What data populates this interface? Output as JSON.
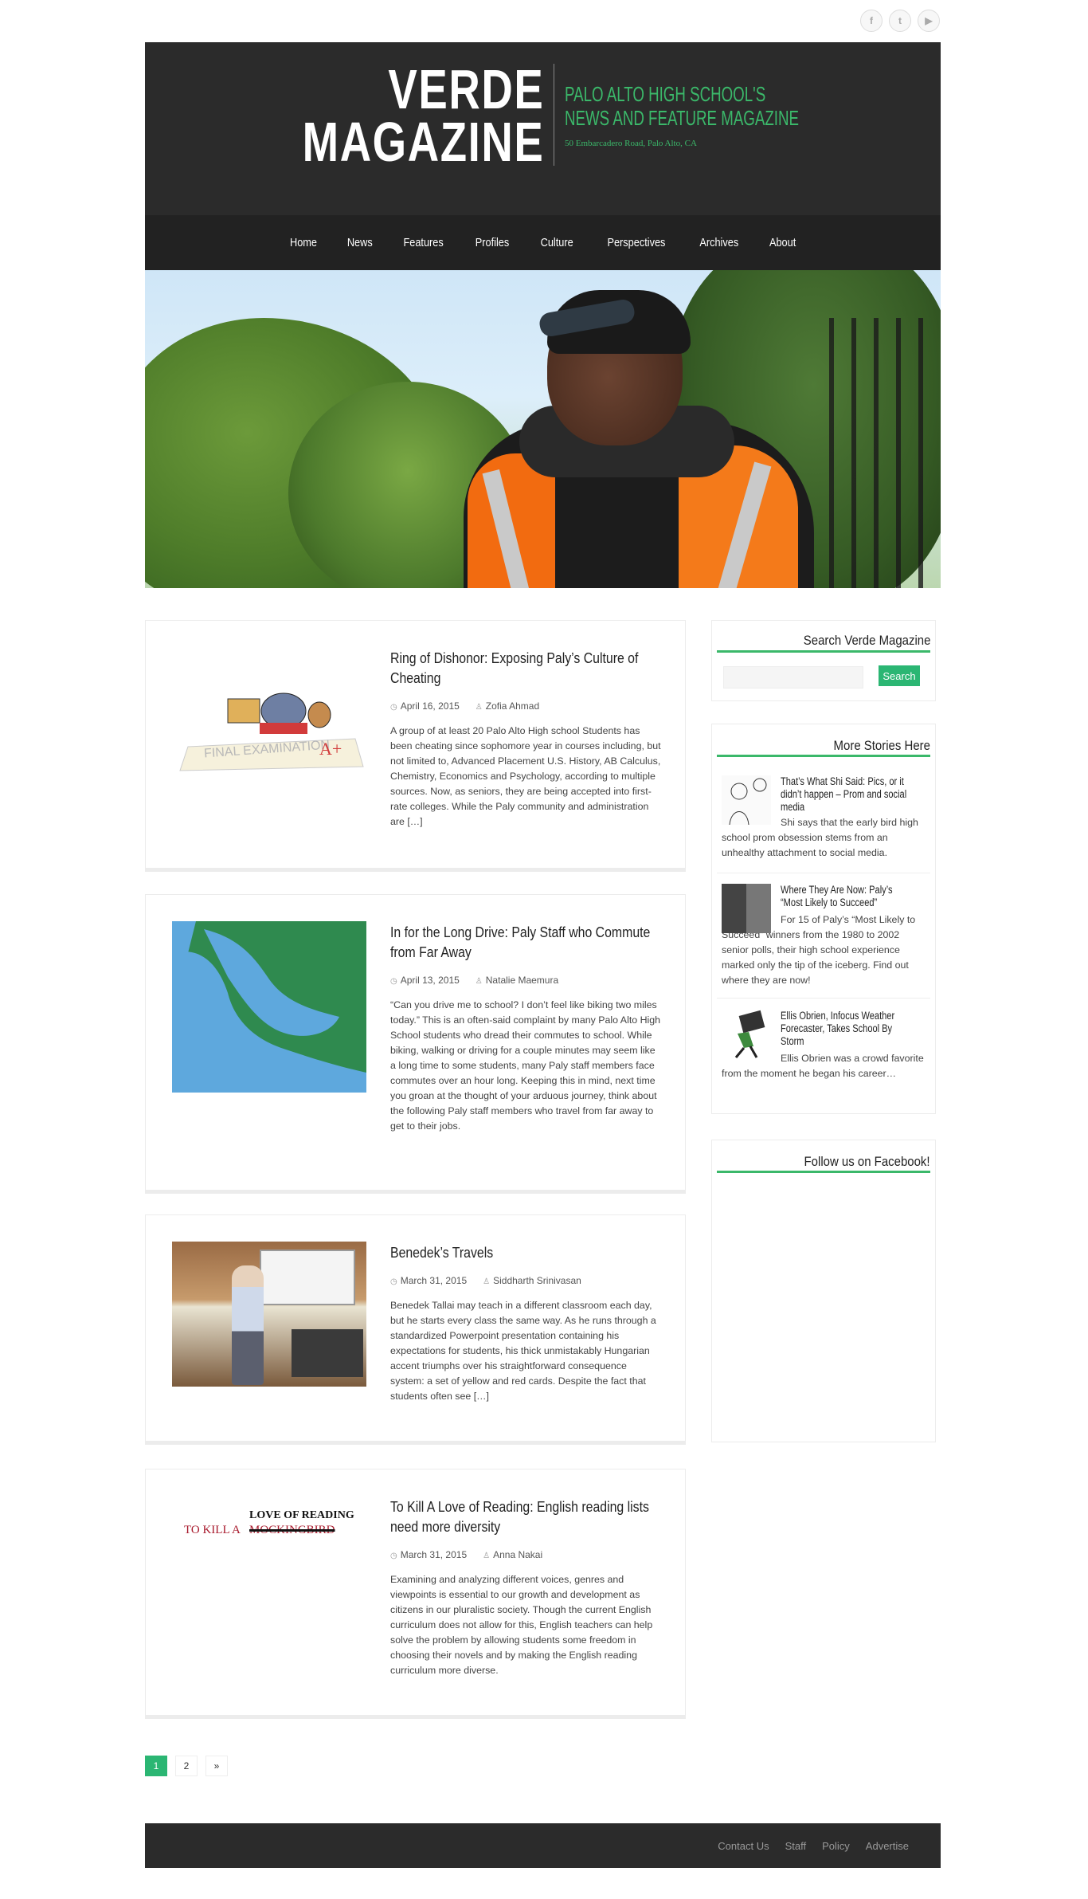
{
  "social": {
    "facebook": "f",
    "twitter": "t",
    "youtube": "▶"
  },
  "header": {
    "title_line1": "VERDE",
    "title_line2": "MAGAZINE",
    "tagline_line1": "PALO ALTO HIGH SCHOOL'S",
    "tagline_line2": "NEWS AND FEATURE MAGAZINE",
    "address": "50 Embarcadero Road, Palo Alto, CA"
  },
  "nav": [
    "Home",
    "News",
    "Features",
    "Profiles",
    "Culture",
    "Perspectives",
    "Archives",
    "About"
  ],
  "posts": [
    {
      "title": "Ring of Dishonor: Exposing Paly’s Culture of Cheating",
      "date": "April 16, 2015",
      "author": "Zofia Ahmad",
      "excerpt": "A group of at least 20 Palo Alto High school Students has been cheating since sophomore year in courses including, but not limited to, Advanced Placement U.S. History, AB Calculus, Chemistry, Economics and Psychology, according to multiple sources. Now, as seniors, they are being accepted into first-rate colleges. While the Paly community and administration are […]",
      "thumb_text": "FINAL EXAMINATION",
      "thumb_grade": "A+"
    },
    {
      "title": "In for the Long Drive: Paly Staff who Commute from Far Away",
      "date": "April 13, 2015",
      "author": "Natalie Maemura",
      "excerpt": "“Can you drive me to school? I don’t feel like biking two miles today.” This is an often-said complaint by many Palo Alto High School students who dread their commutes to school. While biking, walking or driving for a couple minutes may seem like a long time to some students, many Paly staff members face commutes over an hour long. Keeping this in mind, next time you groan at the thought of your arduous journey, think about the following Paly staff members who travel from far away to get to their jobs."
    },
    {
      "title": "Benedek’s Travels",
      "date": "March 31, 2015",
      "author": "Siddharth Srinivasan",
      "excerpt": "Benedek Tallai may teach in a different classroom each day, but he starts every class the same way. As he runs through a standardized Powerpoint presentation containing his expectations for students, his thick unmistakably Hungarian accent triumphs over his straightforward consequence system: a set of yellow and red cards. Despite the fact that students often see […]"
    },
    {
      "title": "To Kill A Love of Reading: English reading lists need more diversity",
      "date": "March 31, 2015",
      "author": "Anna Nakai",
      "excerpt": "Examining and analyzing different voices, genres and viewpoints is essential to our growth and development as citizens in our pluralistic society. Though the current English curriculum does not allow for this, English teachers can help solve the problem by allowing students some freedom in choosing their novels and by making the English reading curriculum more diverse.",
      "thumb_left": "TO KILL A",
      "thumb_struck": "MOCKINGBIRD",
      "thumb_top": "LOVE OF READING"
    }
  ],
  "sidebar": {
    "search_title": "Search Verde Magazine",
    "search_button": "Search",
    "search_placeholder": "",
    "more_title": "More Stories Here",
    "stories": [
      {
        "title": "That’s What Shi Said: Pics, or it didn’t happen – Prom and social media",
        "excerpt": "Shi says that the early bird high school prom obsession stems from an unhealthy attachment to social media."
      },
      {
        "title": "Where They Are Now: Paly’s “Most Likely to Succeed”",
        "excerpt": "For 15 of Paly’s “Most Likely to Succeed” winners from the 1980 to 2002 senior polls, their high school experience marked only the tip of the iceberg. Find out where they are now!"
      },
      {
        "title": "Ellis Obrien, Infocus Weather Forecaster, Takes School By Storm",
        "excerpt": "Ellis Obrien was a crowd favorite from the moment he began his career…"
      }
    ],
    "facebook_title": "Follow us on Facebook!"
  },
  "pagination": [
    "1",
    "2",
    "»"
  ],
  "footer": [
    "Contact Us",
    "Staff",
    "Policy",
    "Advertise"
  ],
  "colors": {
    "accent": "#2bb673",
    "header_bg": "#2b2b2b",
    "tagline": "#3bb86a"
  }
}
